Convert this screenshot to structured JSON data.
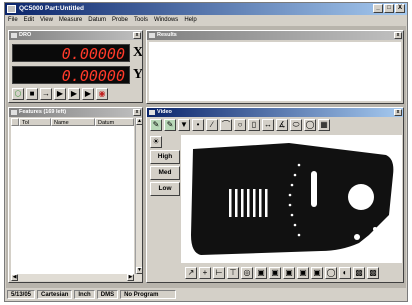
{
  "app": {
    "title": "QC5000 Part:Untitled",
    "minimize": "_",
    "restore": "□",
    "close": "X"
  },
  "menu": [
    "File",
    "Edit",
    "View",
    "Measure",
    "Datum",
    "Probe",
    "Tools",
    "Windows",
    "Help"
  ],
  "dro": {
    "title": "DRO",
    "close": "x",
    "x_value": "0.00000",
    "x_axis": "X",
    "y_value": "0.00000",
    "y_axis": "Y"
  },
  "results": {
    "title": "Results",
    "close": "x"
  },
  "features": {
    "title": "Features (169 left)",
    "close": "x",
    "columns": [
      "",
      "Tol",
      "Name",
      "Datum"
    ]
  },
  "video": {
    "title": "Video",
    "close": "x",
    "lights": [
      "High",
      "Med",
      "Low"
    ]
  },
  "status": {
    "date": "5/13/05",
    "coord": "Cartesian",
    "units": "Inch",
    "angle": "DMS",
    "program": "No Program"
  },
  "colors": {
    "dro_digits": "#ff3a2a",
    "title_active": "#0a246a",
    "part": "#111111"
  }
}
